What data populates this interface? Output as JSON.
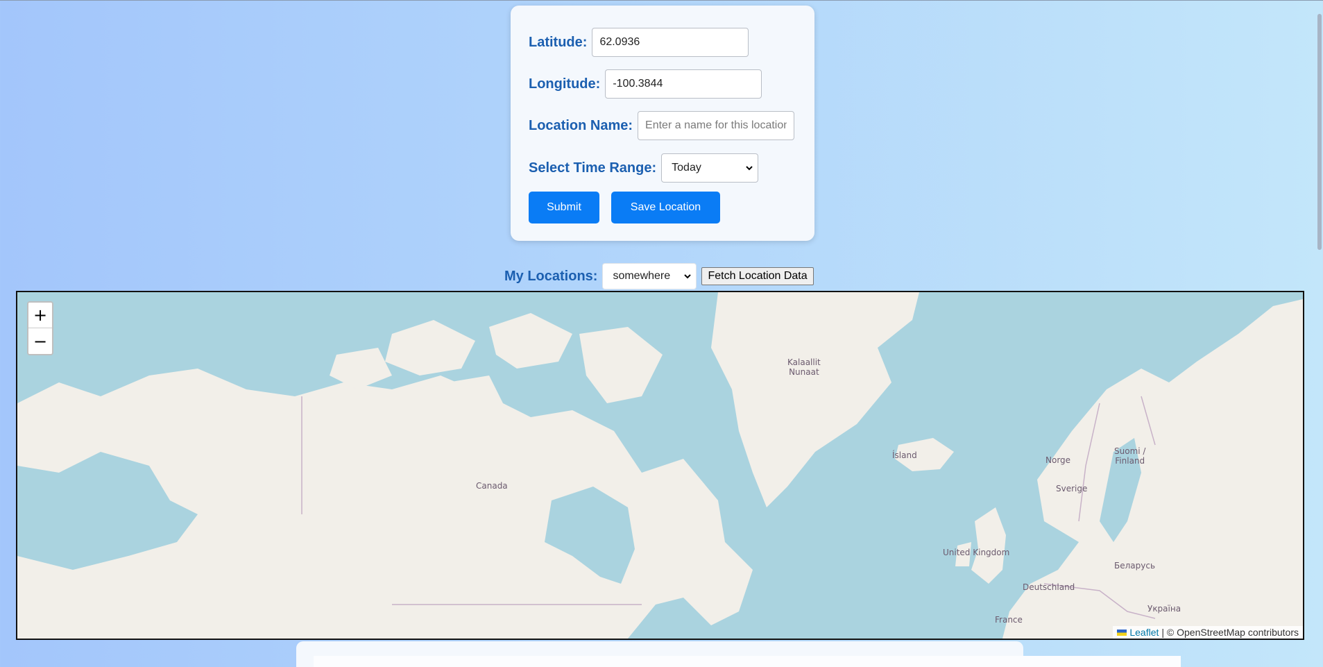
{
  "form": {
    "latitude_label": "Latitude:",
    "latitude_value": "62.0936",
    "longitude_label": "Longitude:",
    "longitude_value": "-100.3844",
    "location_name_label": "Location Name:",
    "location_name_placeholder": "Enter a name for this location",
    "time_range_label": "Select Time Range:",
    "time_range_value": "Today",
    "submit_label": "Submit",
    "save_label": "Save Location"
  },
  "my_locations": {
    "label": "My Locations:",
    "selected": "somewhere",
    "fetch_label": "Fetch Location Data"
  },
  "map": {
    "zoom_in": "+",
    "zoom_out": "−",
    "labels": {
      "greenland": "Kalaallit\nNunaat",
      "canada": "Canada",
      "iceland": "Ísland",
      "norway": "Norge",
      "sweden": "Sverige",
      "finland": "Suomi /\nFinland",
      "uk": "United Kingdom",
      "germany": "Deutschland",
      "belarus": "Беларусь",
      "ukraine": "Україна",
      "france": "France"
    },
    "attribution_link": "Leaflet",
    "attribution_text": "| © OpenStreetMap contributors"
  },
  "colors": {
    "water": "#aad3df",
    "land": "#f2efe9",
    "border": "#c8b2c8",
    "label": "#1b5fb0",
    "button": "#0a7cf5"
  }
}
